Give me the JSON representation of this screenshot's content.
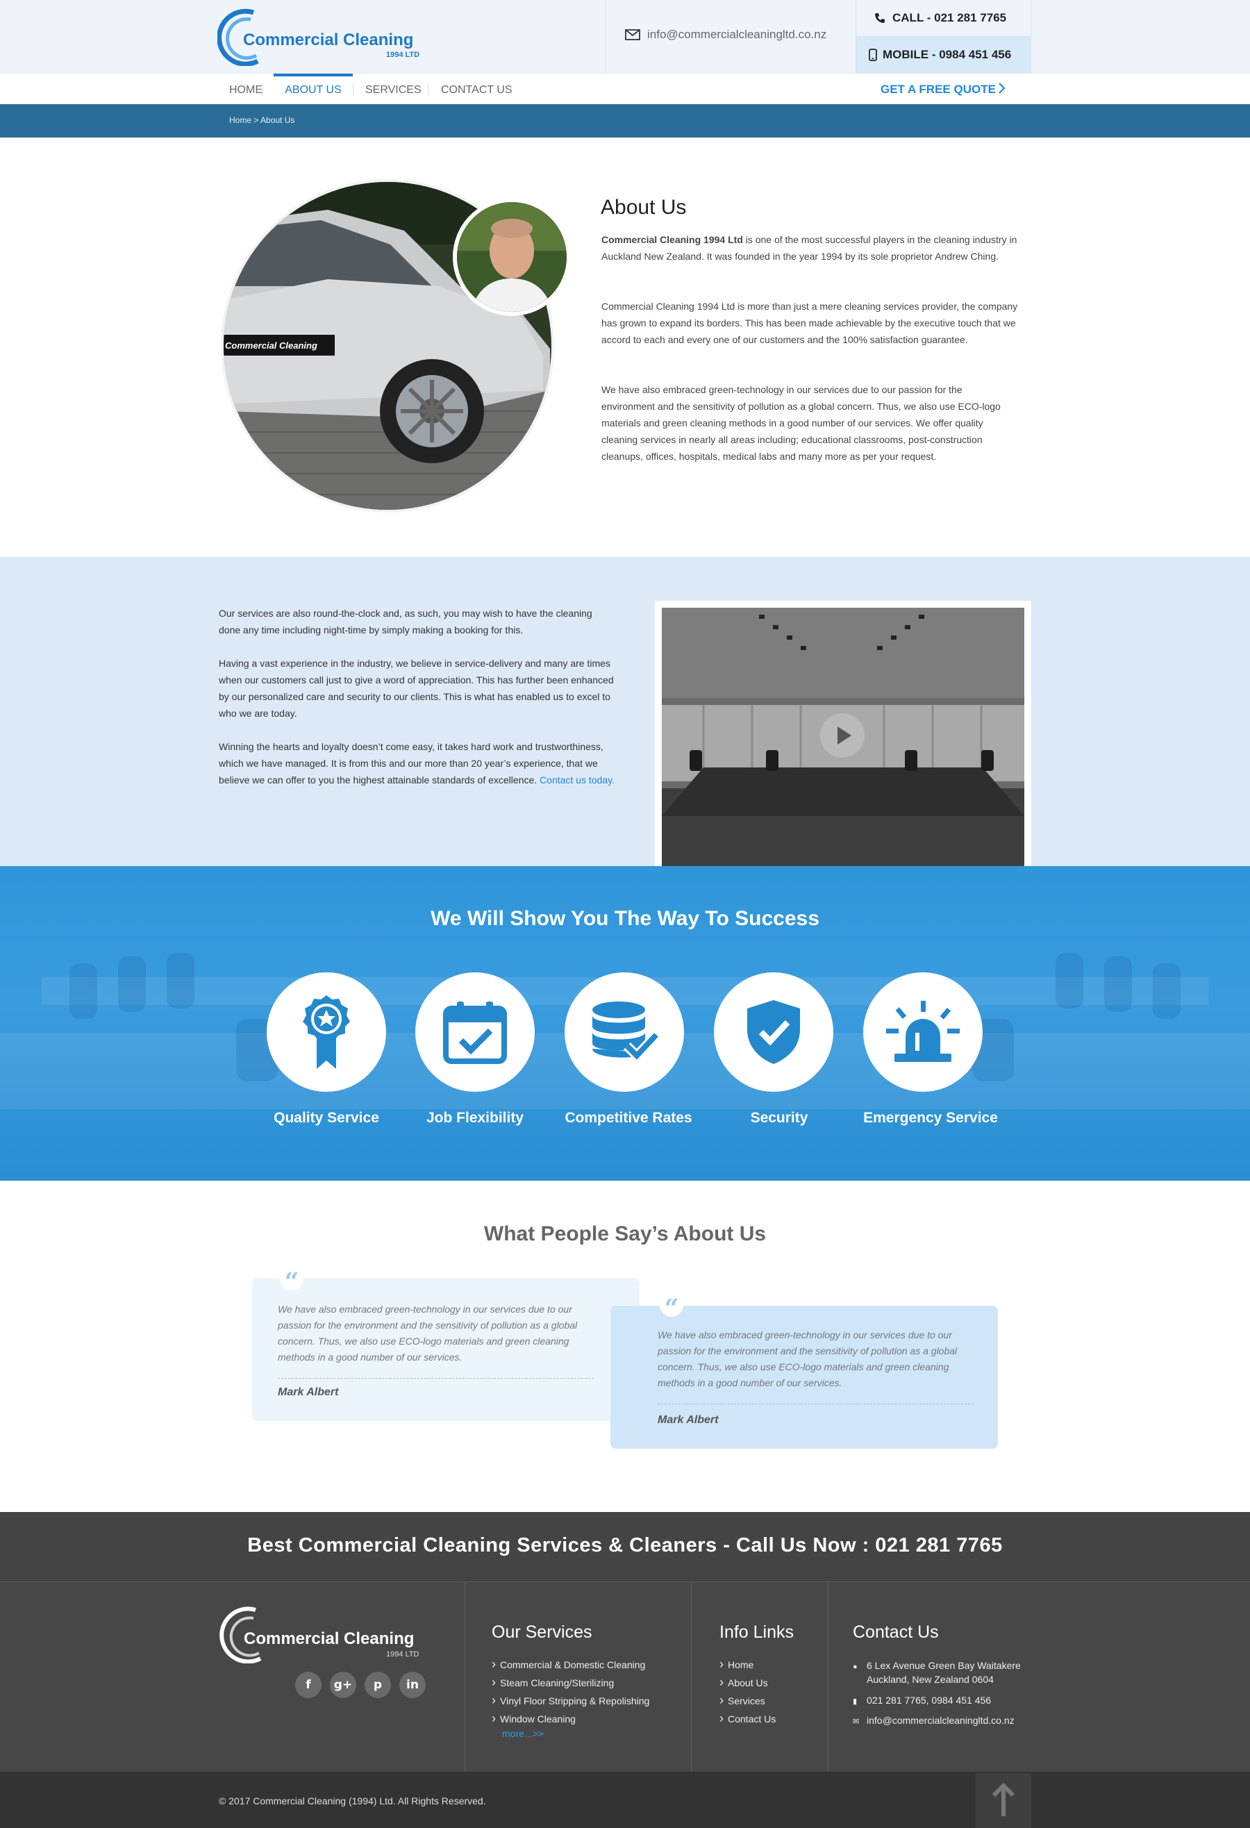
{
  "header": {
    "logo_name": "Commercial Cleaning",
    "logo_sub": "1994 LTD",
    "email": "info@commercialcleaningltd.co.nz",
    "call": "CALL - 021 281 7765",
    "mobile": "MOBILE - 0984 451 456"
  },
  "nav": {
    "items": [
      {
        "label": "HOME"
      },
      {
        "label": "ABOUT US"
      },
      {
        "label": "SERVICES"
      },
      {
        "label": "CONTACT US"
      }
    ],
    "active": "ABOUT US",
    "quote": "GET A FREE QUOTE"
  },
  "breadcrumb": "Home > About Us",
  "about": {
    "title": "About Us",
    "car_decal": "Commercial Cleaning",
    "p1_strong": "Commercial Cleaning 1994 Ltd",
    "p1_rest": " is one of the most successful players in the cleaning industry in Auckland New Zealand. It was founded in the year 1994 by its sole proprietor Andrew Ching.",
    "p2": "Commercial Cleaning 1994 Ltd is more than just a mere cleaning services provider, the company has grown to expand its borders. This has been made achievable by the executive touch that we accord to each and every one of our customers and the 100% satisfaction guarantee.",
    "p3": "We have also embraced green-technology in our services due to our passion for the environment and the sensitivity of pollution as a global concern. Thus, we also use ECO-logo materials and green cleaning methods in a good number of our services. We offer quality cleaning services in nearly all areas including; educational classrooms, post-construction cleanups, offices, hospitals, medical labs and many more as per your request."
  },
  "services_text": {
    "p1": "Our services are also round-the-clock and, as such, you may wish to have the cleaning done any time including night-time by simply making a booking for this.",
    "p2": "Having a vast experience in the industry, we believe in service-delivery and many are times when our customers call just to give a word of appreciation. This has further been enhanced by our personalized care and security to our clients. This is what has enabled us to excel to who we are today.",
    "p3": "Winning the hearts and loyalty doesn’t come easy, it takes hard work and trustworthiness, which we have managed. It is from this and our more than 20 year’s experience, that we believe we can offer to you the highest attainable standards of excellence. ",
    "link": "Contact us today."
  },
  "success": {
    "title": "We Will Show You The Way To Success",
    "features": [
      {
        "label": "Quality Service",
        "icon": "award-ribbon-icon"
      },
      {
        "label": "Job Flexibility",
        "icon": "calendar-check-icon"
      },
      {
        "label": "Competitive Rates",
        "icon": "database-check-icon"
      },
      {
        "label": "Security",
        "icon": "shield-check-icon"
      },
      {
        "label": "Emergency Service",
        "icon": "siren-icon"
      }
    ]
  },
  "testimonials": {
    "title": "What People Say’s About Us",
    "items": [
      {
        "text": "We have also embraced green-technology in our services due to our passion for the environment and the sensitivity of pollution as a global concern. Thus, we also use ECO-logo materials and green cleaning methods in a good number of our services.",
        "name": "Mark Albert"
      },
      {
        "text": "We have also embraced green-technology in our services due to our passion for the environment and the sensitivity of pollution as a global concern. Thus, we also use ECO-logo materials and green cleaning methods in a good number of our services.",
        "name": "Mark Albert"
      }
    ]
  },
  "cta": "Best Commercial Cleaning Services & Cleaners - Call Us Now : 021 281 7765",
  "footer": {
    "logo_name": "Commercial Cleaning",
    "logo_sub": "1994 LTD",
    "social": [
      "f",
      "g+",
      "p",
      "in"
    ],
    "services_title": "Our Services",
    "services": [
      "Commercial & Domestic Cleaning",
      "Steam Cleaning/Sterilizing",
      "Vinyl Floor Stripping & Repolishing",
      "Window Cleaning"
    ],
    "more": "more...>>",
    "info_title": "Info Links",
    "info": [
      "Home",
      "About Us",
      "Services",
      "Contact Us"
    ],
    "contact_title": "Contact Us",
    "address1": "6 Lex Avenue Green Bay Waitakere",
    "address2": "Auckland, New Zealand 0604",
    "phones": "021 281 7765, 0984 451 456",
    "email": "info@commercialcleaningltd.co.nz",
    "copyright": "© 2017 Commercial Cleaning (1994) Ltd. All Rights Reserved."
  },
  "colors": {
    "brand_blue": "#1f78c8",
    "accent_blue": "#3a9bde",
    "breadcrumb_bar": "#2a6e98",
    "footer_dark": "#474747"
  }
}
